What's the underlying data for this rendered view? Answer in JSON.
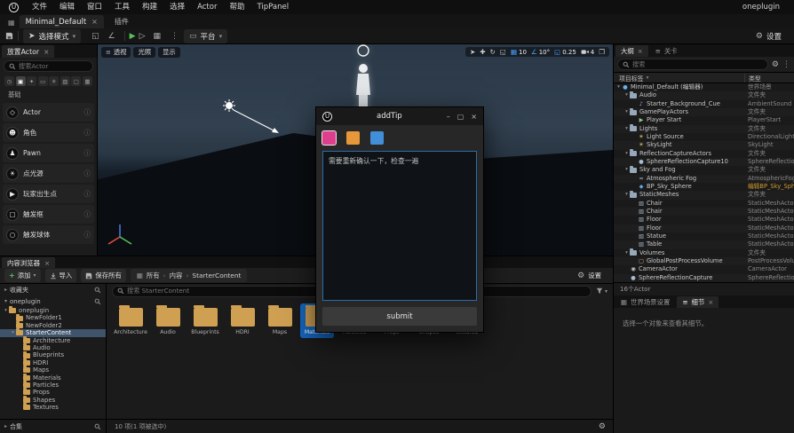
{
  "window": {
    "menus": [
      "文件",
      "编辑",
      "窗口",
      "工具",
      "构建",
      "选择",
      "Actor",
      "帮助",
      "TipPanel"
    ],
    "right_label": "oneplugin"
  },
  "tab_bar": {
    "level_tab": "Minimal_Default",
    "plugins_label": "插件"
  },
  "toolbar": {
    "mode_label": "选择模式",
    "platforms_label": "平台",
    "settings_label": "设置"
  },
  "icons": {
    "info": "ⓘ",
    "gear": "⚙",
    "caret_down": "▾",
    "caret_right": "▸",
    "close": "×",
    "minimize": "–",
    "maximize": "▢",
    "kebab": "⋮",
    "play": "▶",
    "skip": "▷",
    "plus": "+",
    "grid": "▦",
    "angle": "∠",
    "move": "✚",
    "rotate": "↻",
    "scale": "◱",
    "select": "➤",
    "viewport_maximize": "❐",
    "levels": "≡",
    "menu": "≡",
    "monitor": "▭"
  },
  "placement_panel": {
    "title": "放置Actor",
    "search_placeholder": "搜索Actor",
    "category_label": "基础",
    "categories": [
      {
        "name": "recent-icon",
        "glyph": "◷",
        "selected": false
      },
      {
        "name": "basic-icon",
        "glyph": "▣",
        "selected": true
      },
      {
        "name": "lights-icon",
        "glyph": "✦",
        "selected": false
      },
      {
        "name": "cinematic-icon",
        "glyph": "▭",
        "selected": false
      },
      {
        "name": "visual-effects-icon",
        "glyph": "✳",
        "selected": false
      },
      {
        "name": "geometry-icon",
        "glyph": "▧",
        "selected": false
      },
      {
        "name": "volumes-icon",
        "glyph": "▢",
        "selected": false
      },
      {
        "name": "all-classes-icon",
        "glyph": "▦",
        "selected": false
      }
    ],
    "items": [
      {
        "label": "Actor",
        "icon": "actor-icon",
        "glyph": "◇"
      },
      {
        "label": "角色",
        "icon": "character-icon",
        "glyph": "☻"
      },
      {
        "label": "Pawn",
        "icon": "pawn-icon",
        "glyph": "♟"
      },
      {
        "label": "点光源",
        "icon": "point-light-icon",
        "glyph": "☀"
      },
      {
        "label": "玩家出生点",
        "icon": "player-start-icon",
        "glyph": "▶"
      },
      {
        "label": "触发框",
        "icon": "trigger-box-icon",
        "glyph": "▢"
      },
      {
        "label": "触发球体",
        "icon": "trigger-sphere-icon",
        "glyph": "○"
      }
    ]
  },
  "viewport": {
    "perspective_label": "透视",
    "lit_label": "光照",
    "show_label": "显示",
    "grid_snap": "10",
    "rotation_snap": "10°",
    "scale_snap": "0.25",
    "camera_speed": "4"
  },
  "outliner": {
    "tab": "大纲",
    "levels_tab": "关卡",
    "search_placeholder": "搜索",
    "col_label": "项目标签",
    "col_type": "类型",
    "status": "16个Actor",
    "rows": [
      {
        "label": "Minimal_Default (编辑器)",
        "type": "世界场景",
        "depth": 0,
        "expand": true,
        "icon": "world-icon",
        "glyph": "●",
        "color": "#6ab0e8"
      },
      {
        "label": "Audio",
        "type": "文件夹",
        "depth": 1,
        "expand": true,
        "icon": "folder-icon"
      },
      {
        "label": "Starter_Background_Cue",
        "type": "AmbientSound",
        "depth": 2,
        "icon": "sound-icon",
        "glyph": "♪",
        "color": "#c39be0"
      },
      {
        "label": "GamePlayActors",
        "type": "文件夹",
        "depth": 1,
        "expand": true,
        "icon": "folder-icon"
      },
      {
        "label": "Player Start",
        "type": "PlayerStart",
        "depth": 2,
        "icon": "player-start-icon",
        "glyph": "▶",
        "color": "#8cc98c"
      },
      {
        "label": "Lights",
        "type": "文件夹",
        "depth": 1,
        "expand": true,
        "icon": "folder-icon"
      },
      {
        "label": "Light Source",
        "type": "DirectionalLight",
        "depth": 2,
        "icon": "directional-light-icon",
        "glyph": "☀",
        "color": "#e3c96a"
      },
      {
        "label": "SkyLight",
        "type": "SkyLight",
        "depth": 2,
        "icon": "sky-light-icon",
        "glyph": "☀",
        "color": "#e3c96a"
      },
      {
        "label": "ReflectionCaptureActors",
        "type": "文件夹",
        "depth": 1,
        "expand": true,
        "icon": "folder-icon"
      },
      {
        "label": "SphereReflectionCapture10",
        "type": "SphereReflectionCapture",
        "depth": 2,
        "icon": "sphere-capture-icon",
        "glyph": "●",
        "color": "#a8bdd2"
      },
      {
        "label": "Sky and Fog",
        "type": "文件夹",
        "depth": 1,
        "expand": true,
        "icon": "folder-icon"
      },
      {
        "label": "Atmospheric Fog",
        "type": "AtmosphericFog",
        "depth": 2,
        "icon": "fog-icon",
        "glyph": "≈",
        "color": "#a8bdd2"
      },
      {
        "label": "BP_Sky_Sphere",
        "type": "编辑BP_Sky_Sphere",
        "depth": 2,
        "icon": "blueprint-icon",
        "glyph": "◆",
        "color": "#58a6e8",
        "type_link": true
      },
      {
        "label": "StaticMeshes",
        "type": "文件夹",
        "depth": 1,
        "expand": true,
        "icon": "folder-icon"
      },
      {
        "label": "Chair",
        "type": "StaticMeshActor",
        "depth": 2,
        "icon": "static-mesh-icon",
        "glyph": "▧",
        "color": "#9fb0c0"
      },
      {
        "label": "Chair",
        "type": "StaticMeshActor",
        "depth": 2,
        "icon": "static-mesh-icon",
        "glyph": "▧",
        "color": "#9fb0c0"
      },
      {
        "label": "Floor",
        "type": "StaticMeshActor",
        "depth": 2,
        "icon": "static-mesh-icon",
        "glyph": "▧",
        "color": "#9fb0c0"
      },
      {
        "label": "Floor",
        "type": "StaticMeshActor",
        "depth": 2,
        "icon": "static-mesh-icon",
        "glyph": "▧",
        "color": "#9fb0c0"
      },
      {
        "label": "Statue",
        "type": "StaticMeshActor",
        "depth": 2,
        "icon": "static-mesh-icon",
        "glyph": "▧",
        "color": "#9fb0c0"
      },
      {
        "label": "Table",
        "type": "StaticMeshActor",
        "depth": 2,
        "icon": "static-mesh-icon",
        "glyph": "▧",
        "color": "#9fb0c0"
      },
      {
        "label": "Volumes",
        "type": "文件夹",
        "depth": 1,
        "expand": true,
        "icon": "folder-icon"
      },
      {
        "label": "GlobalPostProcessVolume",
        "type": "PostProcessVolume",
        "depth": 2,
        "icon": "volume-icon",
        "glyph": "▢",
        "color": "#d8a070"
      },
      {
        "label": "CameraActor",
        "type": "CameraActor",
        "depth": 1,
        "icon": "camera-icon",
        "glyph": "◉",
        "color": "#c0c0c0"
      },
      {
        "label": "SphereReflectionCapture",
        "type": "SphereReflectionCapture",
        "depth": 1,
        "icon": "sphere-capture-icon",
        "glyph": "●",
        "color": "#a8bdd2"
      }
    ]
  },
  "details": {
    "world_settings_tab": "世界场景设置",
    "details_tab": "细节",
    "empty_message": "选择一个对象来查看其细节。"
  },
  "content_browser": {
    "tab": "内容浏览器",
    "add_label": "添加",
    "import_label": "导入",
    "save_all_label": "保存所有",
    "breadcrumbs": [
      "所有",
      "内容",
      "StarterContent"
    ],
    "settings_label": "设置",
    "search_placeholder": "搜索 StarterContent",
    "sidebar": {
      "favorites_label": "收藏夹",
      "project_label": "oneplugin",
      "collections_label": "合集",
      "tree": [
        {
          "label": "oneplugin",
          "depth": 0,
          "expanded": true,
          "children": true
        },
        {
          "label": "NewFolder1",
          "depth": 1
        },
        {
          "label": "NewFolder2",
          "depth": 1
        },
        {
          "label": "StarterContent",
          "depth": 1,
          "expanded": true,
          "children": true,
          "selected": true
        },
        {
          "label": "Architecture",
          "depth": 2
        },
        {
          "label": "Audio",
          "depth": 2
        },
        {
          "label": "Blueprints",
          "depth": 2
        },
        {
          "label": "HDRI",
          "depth": 2
        },
        {
          "label": "Maps",
          "depth": 2
        },
        {
          "label": "Materials",
          "depth": 2
        },
        {
          "label": "Particles",
          "depth": 2
        },
        {
          "label": "Props",
          "depth": 2
        },
        {
          "label": "Shapes",
          "depth": 2
        },
        {
          "label": "Textures",
          "depth": 2
        }
      ]
    },
    "folders": [
      {
        "name": "Architecture"
      },
      {
        "name": "Audio"
      },
      {
        "name": "Blueprints"
      },
      {
        "name": "HDRI"
      },
      {
        "name": "Maps"
      },
      {
        "name": "Materials",
        "selected": true
      },
      {
        "name": "Particles"
      },
      {
        "name": "Props"
      },
      {
        "name": "Shapes"
      },
      {
        "name": "Textures"
      }
    ],
    "status": "10 项(1 项被选中)"
  },
  "dialog": {
    "title": "addTip",
    "message": "需要重新确认一下，检查一遍",
    "submit_label": "submit",
    "swatches": [
      {
        "name": "pink",
        "color": "#de3f8c",
        "selected": true
      },
      {
        "name": "orange",
        "color": "#e6973a",
        "selected": false
      },
      {
        "name": "blue",
        "color": "#418fd8",
        "selected": false
      }
    ]
  }
}
